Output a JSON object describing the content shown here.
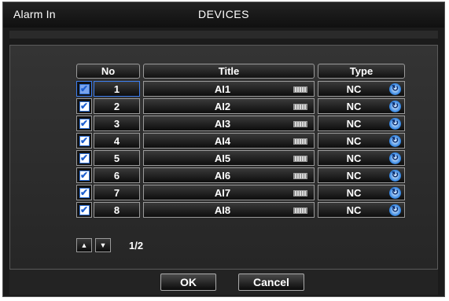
{
  "window": {
    "section": "Alarm In",
    "title": "DEVICES"
  },
  "table": {
    "headers": {
      "no": "No",
      "title": "Title",
      "type": "Type"
    },
    "rows": [
      {
        "checked": true,
        "no": "1",
        "title": "AI1",
        "type": "NC"
      },
      {
        "checked": true,
        "no": "2",
        "title": "AI2",
        "type": "NC"
      },
      {
        "checked": true,
        "no": "3",
        "title": "AI3",
        "type": "NC"
      },
      {
        "checked": true,
        "no": "4",
        "title": "AI4",
        "type": "NC"
      },
      {
        "checked": true,
        "no": "5",
        "title": "AI5",
        "type": "NC"
      },
      {
        "checked": true,
        "no": "6",
        "title": "AI6",
        "type": "NC"
      },
      {
        "checked": true,
        "no": "7",
        "title": "AI7",
        "type": "NC"
      },
      {
        "checked": true,
        "no": "8",
        "title": "AI8",
        "type": "NC"
      }
    ]
  },
  "pager": {
    "up_icon": "triangle-up-icon",
    "down_icon": "triangle-down-icon",
    "page": "1/2"
  },
  "buttons": {
    "ok": "OK",
    "cancel": "Cancel"
  },
  "icons": {
    "checkbox": "checkmark-icon",
    "keyboard": "keyboard-icon",
    "cycle": "cycle-icon"
  },
  "colors": {
    "accent": "#3d7ef0",
    "checkmark": "#1d5fd0"
  }
}
